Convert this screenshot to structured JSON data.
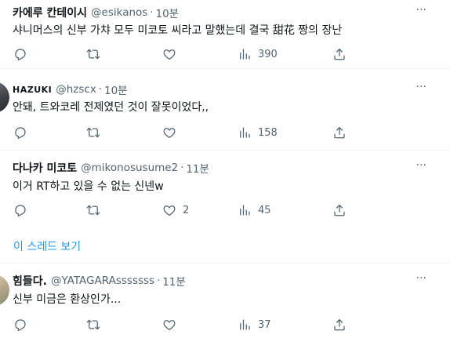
{
  "tweets": [
    {
      "name": "카에루 칸테이시",
      "handle": "@esikanos",
      "dot": "·",
      "time": "10분",
      "more": "···",
      "text": "샤니머스의 신부 가챠 모두 미코토 씨라고 말했는데 결국 甜花 짱의 장난",
      "replies": "",
      "retweets": "",
      "likes": "",
      "views": "390"
    },
    {
      "name": "HAZUKI",
      "handle": "@hzscx",
      "dot": "·",
      "time": "10분",
      "more": "···",
      "text": "안돼, 트와코레 전제였던 것이 잘못이었다,,",
      "replies": "",
      "retweets": "",
      "likes": "",
      "views": "158"
    },
    {
      "name": "다나카 미코토",
      "handle": "@mikonosusume2",
      "dot": "·",
      "time": "11분",
      "more": "···",
      "text": "이거 RT하고 있을 수 없는 신넨w",
      "replies": "",
      "retweets": "",
      "likes": "2",
      "views": "45"
    },
    {
      "name": "힘들다.",
      "handle": "@YATAGARAsssssss",
      "dot": "·",
      "time": "11분",
      "more": "···",
      "text": "신부 미금은 환상인가...",
      "replies": "",
      "retweets": "",
      "likes": "",
      "views": "37"
    }
  ],
  "thread_link": "이 스레드 보기",
  "icons": {
    "reply": "reply-icon",
    "retweet": "retweet-icon",
    "like": "heart-icon",
    "views": "views-chart-icon",
    "share": "share-icon"
  }
}
